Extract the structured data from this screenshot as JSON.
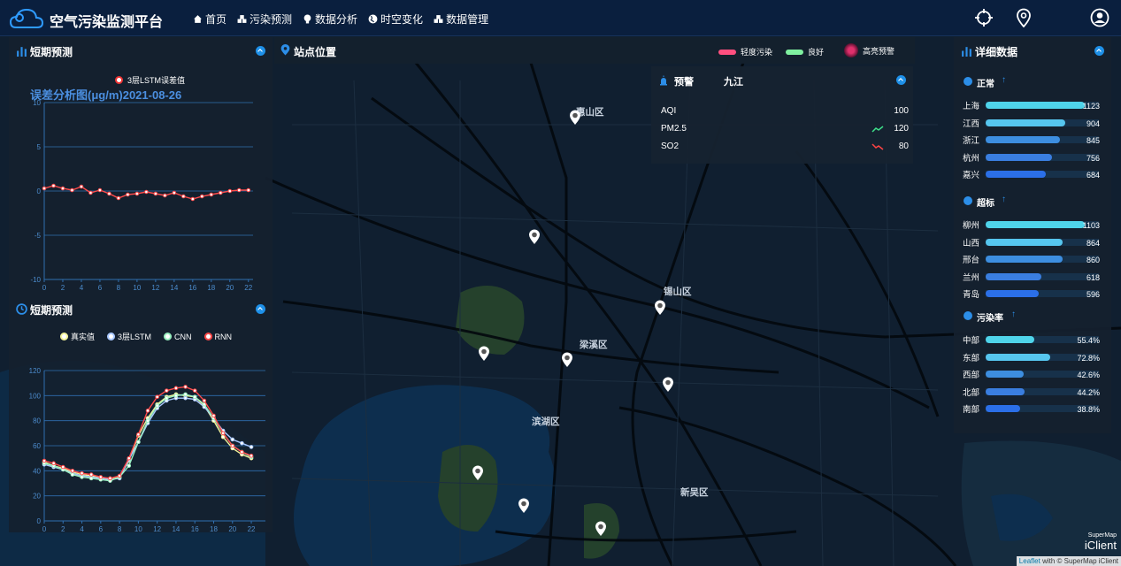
{
  "header": {
    "title": "空气污染监测平台",
    "nav": [
      {
        "label": "首页"
      },
      {
        "label": "污染预测"
      },
      {
        "label": "数据分析"
      },
      {
        "label": "时空变化"
      },
      {
        "label": "数据管理"
      }
    ]
  },
  "panels": {
    "short_forecast_1": {
      "title": "短期预测",
      "legend": "3层LSTM误差值",
      "chart_title": "误差分析图(μg/m)2021-08-26"
    },
    "short_forecast_2": {
      "title": "短期预测",
      "legend": [
        "真实值",
        "3层LSTM",
        "CNN",
        "RNN"
      ]
    },
    "site_location": {
      "title": "站点位置",
      "legend": [
        {
          "label": "轻度污染",
          "color": "#ff4f7f"
        },
        {
          "label": "良好",
          "color": "#7ff0a0"
        },
        {
          "label": "高亮预警",
          "color": "#b0185a"
        }
      ]
    },
    "alarm": {
      "title": "预警",
      "city": "九江",
      "rows": [
        {
          "name": "AQI",
          "value": "100"
        },
        {
          "name": "PM2.5",
          "value": "120",
          "trend": "up"
        },
        {
          "name": "SO2",
          "value": "80",
          "trend": "down"
        }
      ]
    },
    "details": {
      "title": "详细数据",
      "sections": [
        {
          "title": "正常",
          "rows": [
            {
              "city": "上海",
              "value": "1123",
              "frac": 1.0
            },
            {
              "city": "江西",
              "value": "904",
              "frac": 0.8
            },
            {
              "city": "浙江",
              "value": "845",
              "frac": 0.75
            },
            {
              "city": "杭州",
              "value": "756",
              "frac": 0.67
            },
            {
              "city": "嘉兴",
              "value": "684",
              "frac": 0.61
            }
          ]
        },
        {
          "title": "超标",
          "rows": [
            {
              "city": "柳州",
              "value": "1103",
              "frac": 1.0
            },
            {
              "city": "山西",
              "value": "864",
              "frac": 0.78
            },
            {
              "city": "邢台",
              "value": "860",
              "frac": 0.78
            },
            {
              "city": "兰州",
              "value": "618",
              "frac": 0.56
            },
            {
              "city": "青岛",
              "value": "596",
              "frac": 0.54
            }
          ]
        },
        {
          "title": "污染率",
          "rows": [
            {
              "city": "中部",
              "value": "55.4%",
              "frac": 0.554
            },
            {
              "city": "东部",
              "value": "72.8%",
              "frac": 0.728
            },
            {
              "city": "西部",
              "value": "42.6%",
              "frac": 0.426
            },
            {
              "city": "北部",
              "value": "44.2%",
              "frac": 0.442
            },
            {
              "city": "南部",
              "value": "38.8%",
              "frac": 0.388
            }
          ]
        }
      ]
    }
  },
  "map": {
    "districts": [
      "锡山区",
      "梁溪区",
      "滨湖区",
      "新吴区",
      "惠山区"
    ],
    "attribution": "Leaflet",
    "attribution2": "with © SuperMap iClient",
    "brand_top": "SuperMap",
    "brand": "iClient"
  },
  "chart_data": [
    {
      "type": "line",
      "title": "误差分析图(μg/m)2021-08-26",
      "series": [
        {
          "name": "3层LSTM误差值",
          "values": [
            0.3,
            0.6,
            0.3,
            0.1,
            0.5,
            -0.2,
            0.1,
            -0.3,
            -0.8,
            -0.4,
            -0.3,
            -0.1,
            -0.3,
            -0.5,
            -0.2,
            -0.6,
            -0.9,
            -0.6,
            -0.4,
            -0.2,
            0.0,
            0.1,
            0.1
          ]
        }
      ],
      "x": [
        0,
        1,
        2,
        3,
        4,
        5,
        6,
        7,
        8,
        9,
        10,
        11,
        12,
        13,
        14,
        15,
        16,
        17,
        18,
        19,
        20,
        21,
        22
      ],
      "xticks": [
        0,
        2,
        4,
        6,
        8,
        10,
        12,
        14,
        16,
        18,
        20,
        22
      ],
      "ylim": [
        -10,
        10
      ],
      "yticks": [
        -10,
        -5,
        0,
        5,
        10
      ]
    },
    {
      "type": "line",
      "x": [
        0,
        1,
        2,
        3,
        4,
        5,
        6,
        7,
        8,
        9,
        10,
        11,
        12,
        13,
        14,
        15,
        16,
        17,
        18,
        19,
        20,
        21,
        22,
        23
      ],
      "xticks": [
        0,
        2,
        4,
        6,
        8,
        10,
        12,
        14,
        16,
        18,
        20,
        22
      ],
      "ylim": [
        0,
        120
      ],
      "yticks": [
        0,
        20,
        40,
        60,
        80,
        100,
        120
      ],
      "series": [
        {
          "name": "真实值",
          "color": "#f3f39a",
          "values": [
            47,
            44,
            42,
            39,
            37,
            36,
            34,
            33,
            35,
            48,
            68,
            82,
            93,
            99,
            101,
            100,
            99,
            92,
            80,
            67,
            58,
            53,
            50
          ]
        },
        {
          "name": "3层LSTM",
          "color": "#a9c8ff",
          "values": [
            45,
            43,
            41,
            38,
            36,
            35,
            34,
            33,
            34,
            49,
            63,
            78,
            90,
            96,
            98,
            98,
            97,
            91,
            82,
            72,
            65,
            62,
            59
          ]
        },
        {
          "name": "CNN",
          "color": "#9af0c0",
          "values": [
            46,
            44,
            41,
            37,
            35,
            34,
            33,
            32,
            35,
            44,
            63,
            80,
            92,
            98,
            100,
            101,
            99,
            93,
            82,
            70,
            60,
            55,
            51
          ]
        },
        {
          "name": "RNN",
          "color": "#ff4a4a",
          "values": [
            48,
            46,
            43,
            40,
            38,
            37,
            35,
            34,
            36,
            50,
            69,
            88,
            99,
            104,
            106,
            107,
            104,
            96,
            84,
            70,
            60,
            55,
            52
          ]
        }
      ]
    }
  ]
}
